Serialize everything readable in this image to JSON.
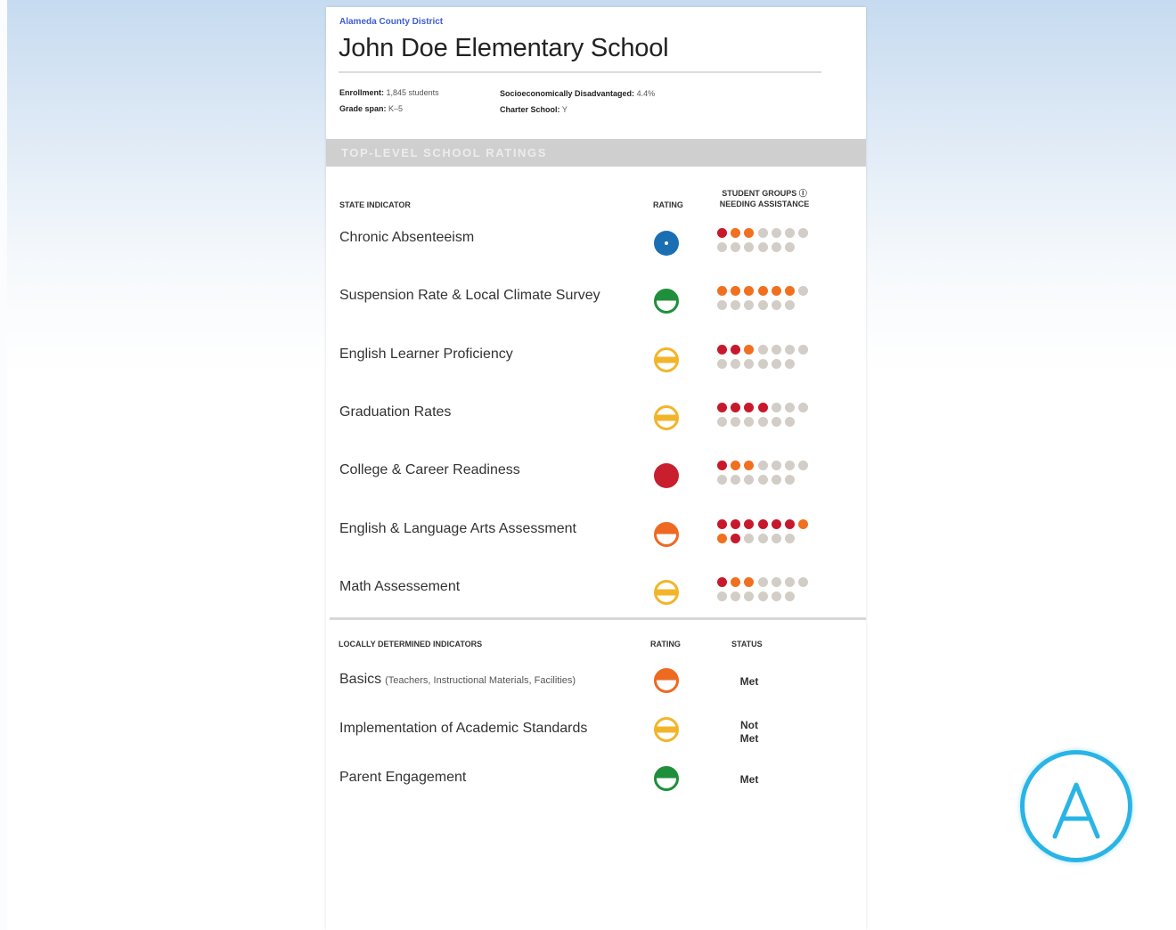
{
  "district": "Alameda County District",
  "school_name": "John Doe Elementary School",
  "meta": {
    "enrollment_label": "Enrollment:",
    "enrollment_value": "1,845 students",
    "grade_span_label": "Grade span:",
    "grade_span_value": "K–5",
    "ses_label": "Socioeconomically Disadvantaged:",
    "ses_value": "4.4%",
    "charter_label": "Charter School:",
    "charter_value": "Y"
  },
  "banner": "TOP-LEVEL SCHOOL RATINGS",
  "state_headers": {
    "indicator": "STATE INDICATOR",
    "rating": "RATING",
    "groups_line1": "STUDENT GROUPS ⓘ",
    "groups_line2": "NEEDING ASSISTANCE"
  },
  "colors": {
    "blue": "#1a6fb3",
    "green": "#1f8f3c",
    "yellow": "#f2b52a",
    "orange": "#ee6a22",
    "red": "#c81e2e",
    "dot_red": "#c8182c",
    "dot_orange": "#f07020",
    "dot_gray": "#d2cdc6"
  },
  "state_indicators": [
    {
      "label": "Chronic Absenteeism",
      "rating": "blue",
      "dots": [
        "r",
        "o",
        "o",
        "g",
        "g",
        "g",
        "g",
        "g",
        "g",
        "g",
        "g",
        "g",
        "g",
        "g"
      ]
    },
    {
      "label": "Suspension Rate & Local Climate Survey",
      "rating": "green",
      "dots": [
        "o",
        "o",
        "o",
        "o",
        "o",
        "o",
        "g",
        "g",
        "g",
        "g",
        "g",
        "g",
        "g",
        "g"
      ]
    },
    {
      "label": "English Learner Proficiency",
      "rating": "yellow",
      "dots": [
        "r",
        "r",
        "o",
        "g",
        "g",
        "g",
        "g",
        "g",
        "g",
        "g",
        "g",
        "g",
        "g",
        "g"
      ]
    },
    {
      "label": "Graduation Rates",
      "rating": "yellow",
      "dots": [
        "r",
        "r",
        "r",
        "r",
        "g",
        "g",
        "g",
        "g",
        "g",
        "g",
        "g",
        "g",
        "g",
        "g"
      ]
    },
    {
      "label": "College & Career Readiness",
      "rating": "red",
      "dots": [
        "r",
        "o",
        "o",
        "g",
        "g",
        "g",
        "g",
        "g",
        "g",
        "g",
        "g",
        "g",
        "g",
        "g"
      ]
    },
    {
      "label": "English & Language Arts Assessment",
      "rating": "orange",
      "dots": [
        "r",
        "r",
        "r",
        "r",
        "r",
        "r",
        "o",
        "o",
        "r",
        "g",
        "g",
        "g",
        "g",
        "g"
      ]
    },
    {
      "label": "Math Assessement",
      "rating": "yellow",
      "dots": [
        "r",
        "o",
        "o",
        "g",
        "g",
        "g",
        "g",
        "g",
        "g",
        "g",
        "g",
        "g",
        "g",
        "g"
      ]
    }
  ],
  "local_headers": {
    "indicator": "LOCALLY DETERMINED INDICATORS",
    "rating": "RATING",
    "status": "STATUS"
  },
  "local_indicators": [
    {
      "label": "Basics",
      "sub": "(Teachers, Instructional Materials, Facilities)",
      "rating": "orange",
      "status_line1": "Met",
      "status_line2": ""
    },
    {
      "label": "Implementation of Academic Standards",
      "sub": "",
      "rating": "yellow",
      "status_line1": "Not",
      "status_line2": "Met"
    },
    {
      "label": "Parent Engagement",
      "sub": "",
      "rating": "green",
      "status_line1": "Met",
      "status_line2": ""
    }
  ],
  "logo_icon": "letter-a-circle-logo"
}
